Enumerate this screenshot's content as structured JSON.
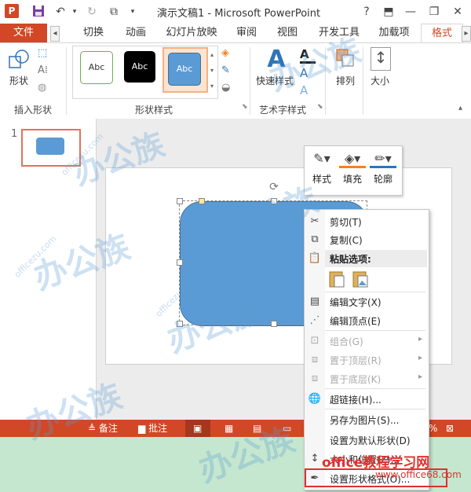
{
  "window": {
    "title": "演示文稿1 - Microsoft PowerPoint",
    "logo_letter": "P",
    "help": "?",
    "minimize": "—",
    "restore": "❐",
    "close": "✕"
  },
  "tabs": {
    "file": "文件",
    "items": [
      "切换",
      "动画",
      "幻灯片放映",
      "审阅",
      "视图",
      "开发工具",
      "加载项",
      "格式"
    ]
  },
  "ribbon": {
    "shape_label": "形状",
    "insert_shapes_group": "插入形状",
    "style_swatches": [
      "Abc",
      "Abc",
      "Abc"
    ],
    "shape_styles_group": "形状样式",
    "quick_styles_label": "快速样式",
    "wordart_group": "艺术字样式",
    "arrange_label": "排列",
    "size_label": "大小",
    "colors": {
      "accent": "#d24726",
      "shape_fill": "#5b9bd5"
    }
  },
  "thumbnail": {
    "number": "1"
  },
  "mini_toolbar": {
    "style": "样式",
    "fill": "填充",
    "outline": "轮廓"
  },
  "context_menu": {
    "cut": "剪切(T)",
    "copy": "复制(C)",
    "paste_options": "粘贴选项:",
    "edit_text": "编辑文字(X)",
    "edit_points": "编辑顶点(E)",
    "group": "组合(G)",
    "bring_front": "置于顶层(R)",
    "send_back": "置于底层(K)",
    "hyperlink": "超链接(H)...",
    "save_as_picture": "另存为图片(S)...",
    "set_default_shape": "设置为默认形状(D)",
    "size_position": "大小和位置(Z)...",
    "format_shape": "设置形状格式(O)..."
  },
  "statusbar": {
    "notes": "备注",
    "comments": "批注",
    "zoom_pct": "%"
  },
  "watermark": {
    "brand": "office教程学习网",
    "url": "www.office68.com",
    "logo_text": "办公族",
    "small": "officezu.com"
  }
}
